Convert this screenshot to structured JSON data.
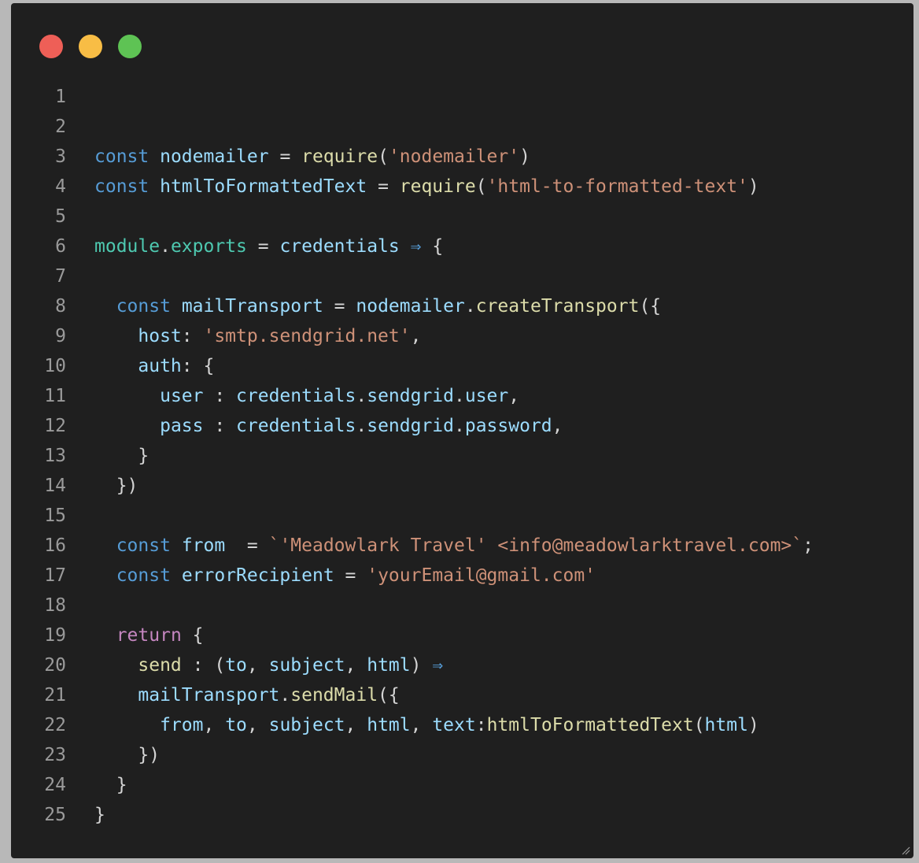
{
  "window": {
    "controls": [
      {
        "name": "close",
        "color": "#ee5f57"
      },
      {
        "name": "minimize",
        "color": "#f8bd45"
      },
      {
        "name": "maximize",
        "color": "#5ec354"
      }
    ]
  },
  "theme": {
    "background": "#1f1f1f",
    "line_number": "#9a9a9a",
    "keyword": "#569cd6",
    "return_keyword": "#c586c0",
    "variable": "#9cdcfe",
    "function": "#dcdcaa",
    "string": "#ce9178",
    "module": "#4ec9b0",
    "punctuation": "#d4d4d4",
    "arrow": "#569cd6"
  },
  "code_lines": [
    {
      "n": "1",
      "tokens": []
    },
    {
      "n": "2",
      "tokens": []
    },
    {
      "n": "3",
      "tokens": [
        [
          "const",
          "keyword"
        ],
        [
          " ",
          "p"
        ],
        [
          "nodemailer",
          "variable"
        ],
        [
          " = ",
          "p"
        ],
        [
          "require",
          "function"
        ],
        [
          "(",
          "p"
        ],
        [
          "'nodemailer'",
          "string"
        ],
        [
          ")",
          "p"
        ]
      ]
    },
    {
      "n": "4",
      "tokens": [
        [
          "const",
          "keyword"
        ],
        [
          " ",
          "p"
        ],
        [
          "htmlToFormattedText",
          "variable"
        ],
        [
          " = ",
          "p"
        ],
        [
          "require",
          "function"
        ],
        [
          "(",
          "p"
        ],
        [
          "'html-to-formatted-text'",
          "string"
        ],
        [
          ")",
          "p"
        ]
      ]
    },
    {
      "n": "5",
      "tokens": []
    },
    {
      "n": "6",
      "tokens": [
        [
          "module",
          "module"
        ],
        [
          ".",
          "p"
        ],
        [
          "exports",
          "module"
        ],
        [
          " = ",
          "p"
        ],
        [
          "credentials",
          "variable"
        ],
        [
          " ",
          "p"
        ],
        [
          "⇒",
          "arrow"
        ],
        [
          " {",
          "p"
        ]
      ]
    },
    {
      "n": "7",
      "tokens": []
    },
    {
      "n": "8",
      "tokens": [
        [
          "  ",
          "p"
        ],
        [
          "const",
          "keyword"
        ],
        [
          " ",
          "p"
        ],
        [
          "mailTransport",
          "variable"
        ],
        [
          " = ",
          "p"
        ],
        [
          "nodemailer",
          "variable"
        ],
        [
          ".",
          "p"
        ],
        [
          "createTransport",
          "function"
        ],
        [
          "({",
          "p"
        ]
      ]
    },
    {
      "n": "9",
      "tokens": [
        [
          "    ",
          "p"
        ],
        [
          "host",
          "variable"
        ],
        [
          ": ",
          "p"
        ],
        [
          "'smtp.sendgrid.net'",
          "string"
        ],
        [
          ",",
          "p"
        ]
      ]
    },
    {
      "n": "10",
      "tokens": [
        [
          "    ",
          "p"
        ],
        [
          "auth",
          "variable"
        ],
        [
          ": {",
          "p"
        ]
      ]
    },
    {
      "n": "11",
      "tokens": [
        [
          "      ",
          "p"
        ],
        [
          "user",
          "variable"
        ],
        [
          " : ",
          "p"
        ],
        [
          "credentials",
          "variable"
        ],
        [
          ".",
          "p"
        ],
        [
          "sendgrid",
          "variable"
        ],
        [
          ".",
          "p"
        ],
        [
          "user",
          "variable"
        ],
        [
          ",",
          "p"
        ]
      ]
    },
    {
      "n": "12",
      "tokens": [
        [
          "      ",
          "p"
        ],
        [
          "pass",
          "variable"
        ],
        [
          " : ",
          "p"
        ],
        [
          "credentials",
          "variable"
        ],
        [
          ".",
          "p"
        ],
        [
          "sendgrid",
          "variable"
        ],
        [
          ".",
          "p"
        ],
        [
          "password",
          "variable"
        ],
        [
          ",",
          "p"
        ]
      ]
    },
    {
      "n": "13",
      "tokens": [
        [
          "    }",
          "p"
        ]
      ]
    },
    {
      "n": "14",
      "tokens": [
        [
          "  })",
          "p"
        ]
      ]
    },
    {
      "n": "15",
      "tokens": []
    },
    {
      "n": "16",
      "tokens": [
        [
          "  ",
          "p"
        ],
        [
          "const",
          "keyword"
        ],
        [
          " ",
          "p"
        ],
        [
          "from",
          "variable"
        ],
        [
          "  = ",
          "p"
        ],
        [
          "`'Meadowlark Travel' <info@meadowlarktravel.com>`",
          "string"
        ],
        [
          ";",
          "p"
        ]
      ]
    },
    {
      "n": "17",
      "tokens": [
        [
          "  ",
          "p"
        ],
        [
          "const",
          "keyword"
        ],
        [
          " ",
          "p"
        ],
        [
          "errorRecipient",
          "variable"
        ],
        [
          " = ",
          "p"
        ],
        [
          "'yourEmail@gmail.com'",
          "string"
        ]
      ]
    },
    {
      "n": "18",
      "tokens": []
    },
    {
      "n": "19",
      "tokens": [
        [
          "  ",
          "p"
        ],
        [
          "return",
          "return_keyword"
        ],
        [
          " {",
          "p"
        ]
      ]
    },
    {
      "n": "20",
      "tokens": [
        [
          "    ",
          "p"
        ],
        [
          "send",
          "function"
        ],
        [
          " : (",
          "p"
        ],
        [
          "to",
          "variable"
        ],
        [
          ", ",
          "p"
        ],
        [
          "subject",
          "variable"
        ],
        [
          ", ",
          "p"
        ],
        [
          "html",
          "variable"
        ],
        [
          ") ",
          "p"
        ],
        [
          "⇒",
          "arrow"
        ]
      ]
    },
    {
      "n": "21",
      "tokens": [
        [
          "    ",
          "p"
        ],
        [
          "mailTransport",
          "variable"
        ],
        [
          ".",
          "p"
        ],
        [
          "sendMail",
          "function"
        ],
        [
          "({",
          "p"
        ]
      ]
    },
    {
      "n": "22",
      "tokens": [
        [
          "      ",
          "p"
        ],
        [
          "from",
          "variable"
        ],
        [
          ", ",
          "p"
        ],
        [
          "to",
          "variable"
        ],
        [
          ", ",
          "p"
        ],
        [
          "subject",
          "variable"
        ],
        [
          ", ",
          "p"
        ],
        [
          "html",
          "variable"
        ],
        [
          ", ",
          "p"
        ],
        [
          "text",
          "variable"
        ],
        [
          ":",
          "p"
        ],
        [
          "htmlToFormattedText",
          "function"
        ],
        [
          "(",
          "p"
        ],
        [
          "html",
          "variable"
        ],
        [
          ")",
          "p"
        ]
      ]
    },
    {
      "n": "23",
      "tokens": [
        [
          "    })",
          "p"
        ]
      ]
    },
    {
      "n": "24",
      "tokens": [
        [
          "  }",
          "p"
        ]
      ]
    },
    {
      "n": "25",
      "tokens": [
        [
          "}",
          "p"
        ]
      ]
    }
  ]
}
